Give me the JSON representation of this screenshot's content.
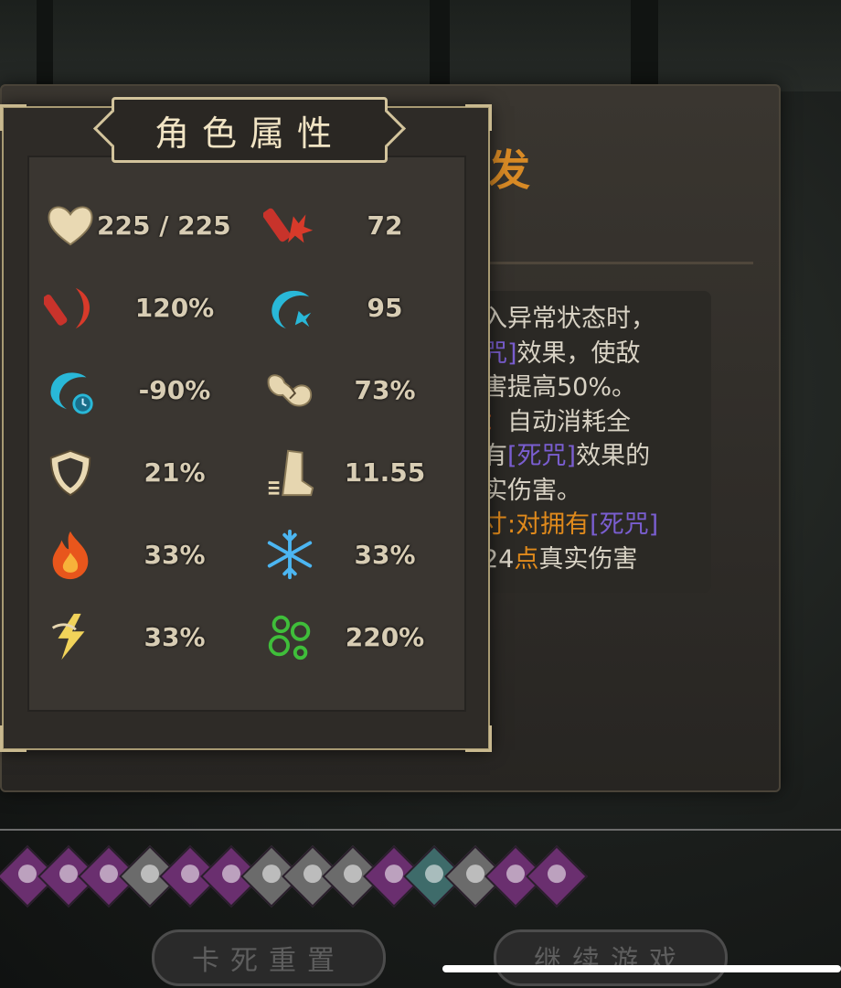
{
  "panel": {
    "title": "角色属性"
  },
  "stats": [
    {
      "icon": "heart-icon",
      "value": "225 / 225"
    },
    {
      "icon": "bottle-burst-icon",
      "value": "72"
    },
    {
      "icon": "red-claw-icon",
      "value": "120%"
    },
    {
      "icon": "blue-claw-icon",
      "value": "95"
    },
    {
      "icon": "blue-claw-timer-icon",
      "value": "-90%"
    },
    {
      "icon": "broken-bone-icon",
      "value": "73%"
    },
    {
      "icon": "shield-icon",
      "value": "21%"
    },
    {
      "icon": "boot-icon",
      "value": "11.55"
    },
    {
      "icon": "fire-icon",
      "value": "33%"
    },
    {
      "icon": "snowflake-icon",
      "value": "33%"
    },
    {
      "icon": "lightning-icon",
      "value": "33%"
    },
    {
      "icon": "poison-bubbles-icon",
      "value": "220%"
    }
  ],
  "skill_card": {
    "title_partial": "发",
    "lines": [
      {
        "parts": [
          {
            "text": "入异常状态时，",
            "style": ""
          }
        ]
      },
      {
        "parts": [
          {
            "text": "咒]",
            "style": "purple"
          },
          {
            "text": "效果，使敌",
            "style": ""
          }
        ]
      },
      {
        "parts": [
          {
            "text": "害提高50%。",
            "style": ""
          }
        ]
      },
      {
        "parts": [
          {
            "text": "：",
            "style": "orange-red"
          },
          {
            "text": "自动消耗全",
            "style": ""
          }
        ]
      },
      {
        "parts": [
          {
            "text": "有",
            "style": ""
          },
          {
            "text": "[死咒]",
            "style": "purple"
          },
          {
            "text": "效果的",
            "style": ""
          }
        ]
      },
      {
        "parts": [
          {
            "text": "实伤害。",
            "style": ""
          }
        ]
      },
      {
        "parts": [
          {
            "text": "寸:对拥有",
            "style": "orange"
          },
          {
            "text": "[死咒]",
            "style": "purple"
          }
        ]
      },
      {
        "parts": [
          {
            "text": "24",
            "style": ""
          },
          {
            "text": "点",
            "style": "orange"
          },
          {
            "text": "真实伤害",
            "style": ""
          }
        ]
      }
    ]
  },
  "relics": [
    {
      "color": "purple"
    },
    {
      "color": "purple"
    },
    {
      "color": "purple"
    },
    {
      "color": "gray"
    },
    {
      "color": "purple"
    },
    {
      "color": "purple"
    },
    {
      "color": "gray"
    },
    {
      "color": "gray"
    },
    {
      "color": "gray"
    },
    {
      "color": "purple"
    },
    {
      "color": "teal"
    },
    {
      "color": "gray"
    },
    {
      "color": "purple"
    },
    {
      "color": "purple"
    }
  ],
  "buttons": {
    "reset_label": "卡死重置",
    "continue_label": "继续游戏"
  },
  "colors": {
    "panel_border": "#a89a73",
    "title_text": "#f1e4c4",
    "stat_text": "#d8cdb4",
    "accent_orange": "#d88a25",
    "curse_purple": "#7a5ed0"
  }
}
